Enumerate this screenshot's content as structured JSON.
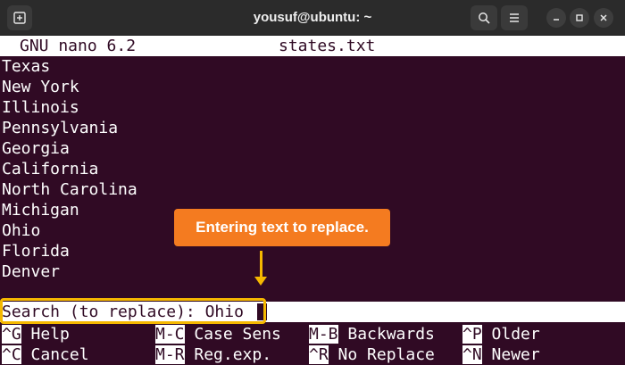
{
  "window": {
    "title": "yousuf@ubuntu: ~"
  },
  "icons": {
    "new_tab": "new-tab-icon",
    "search": "search-icon",
    "menu": "hamburger-menu-icon",
    "minimize": "minimize-icon",
    "maximize": "maximize-icon",
    "close": "close-icon"
  },
  "nano": {
    "version": "GNU nano 6.2",
    "filename": "states.txt",
    "lines": [
      "Texas",
      "New York",
      "Illinois",
      "Pennsylvania",
      "Georgia",
      "California",
      "North Carolina",
      "Michigan",
      "Ohio",
      "Florida",
      "Denver"
    ],
    "prompt": "Search (to replace): Ohio",
    "shortcuts": [
      {
        "key": "^G",
        "label": " Help"
      },
      {
        "key": "M-C",
        "label": " Case Sens"
      },
      {
        "key": "M-B",
        "label": " Backwards"
      },
      {
        "key": "^P",
        "label": " Older"
      },
      {
        "key": "^C",
        "label": " Cancel"
      },
      {
        "key": "M-R",
        "label": " Reg.exp."
      },
      {
        "key": "^R",
        "label": " No Replace"
      },
      {
        "key": "^N",
        "label": " Newer"
      }
    ]
  },
  "annotation": {
    "text": "Entering text to replace.",
    "callout_color": "#f47b20",
    "highlight_color": "#f5b800"
  },
  "colors": {
    "terminal_bg": "#300a24",
    "titlebar_bg": "#2b2b2b"
  }
}
